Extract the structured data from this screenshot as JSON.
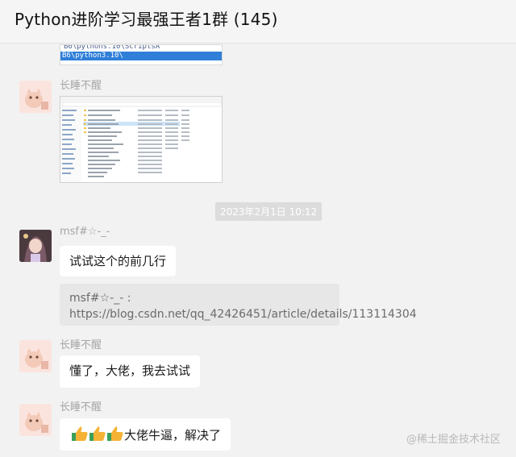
{
  "header": {
    "title": "Python进阶学习最强王者1群 (145)"
  },
  "image_fragment": {
    "line1": "B6\\pythons.10\\ScriptsA",
    "line2": "B6\\python3.10\\"
  },
  "messages": {
    "m1_sender": "长睡不醒",
    "timestamp": "2023年2月1日 10:12",
    "m2_sender": "msf#☆-_-",
    "m2_text": "试试这个的前几行",
    "m2_quote": "msf#☆-_- : https://blog.csdn.net/qq_42426451/article/details/113114304",
    "m3_sender": "长睡不醒",
    "m3_text": "懂了，大佬，我去试试",
    "m4_sender": "长睡不醒",
    "m4_text": "大佬牛逼，解决了",
    "m4_emoji": [
      "thumbs-up",
      "thumbs-up",
      "thumbs-up"
    ]
  },
  "watermark": "@稀土掘金技术社区",
  "colors": {
    "background": "#f2f2f2",
    "bubble": "#ffffff",
    "quote": "#e7e7e7",
    "sender": "#a6a6a6",
    "thumbs": "#f5b335",
    "cuff": "#3aa05a"
  }
}
